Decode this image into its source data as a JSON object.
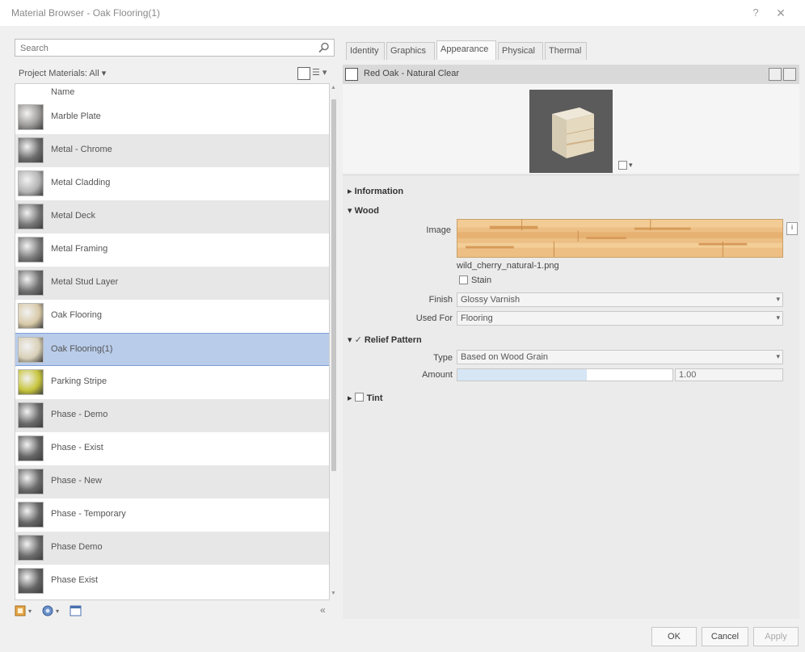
{
  "window": {
    "title": "Material Browser - Oak Flooring(1)",
    "help_glyph": "?",
    "close_glyph": "✕"
  },
  "left": {
    "search_placeholder": "Search",
    "filter_label": "Project Materials: All",
    "filter_arrow": "▾",
    "view_menu_glyph": "☰ ▾",
    "column_name": "Name",
    "items": [
      {
        "label": "Marble Plate",
        "thumb": "#9c9a98"
      },
      {
        "label": "Metal - Chrome",
        "thumb": "#6e6e6e"
      },
      {
        "label": "Metal Cladding",
        "thumb": "#b4b4b4"
      },
      {
        "label": "Metal Deck",
        "thumb": "#767676"
      },
      {
        "label": "Metal Framing",
        "thumb": "#7c7c7c"
      },
      {
        "label": "Metal Stud Layer",
        "thumb": "#727272"
      },
      {
        "label": "Oak Flooring",
        "thumb": "#d8c9a8"
      },
      {
        "label": "Oak Flooring(1)",
        "thumb": "#d8cfb7",
        "selected": true
      },
      {
        "label": "Parking Stripe",
        "thumb": "#c6c43c"
      },
      {
        "label": "Phase - Demo",
        "thumb": "#6a6a6a"
      },
      {
        "label": "Phase - Exist",
        "thumb": "#666666"
      },
      {
        "label": "Phase - New",
        "thumb": "#6b6b6b"
      },
      {
        "label": "Phase - Temporary",
        "thumb": "#676767"
      },
      {
        "label": "Phase Demo",
        "thumb": "#6c6c6c"
      },
      {
        "label": "Phase Exist",
        "thumb": "#646464"
      }
    ],
    "bottom_tools": [
      "material-library-icon",
      "create-material-icon",
      "asset-browser-icon"
    ],
    "collapse_glyph": "«"
  },
  "right": {
    "tabs": [
      "Identity",
      "Graphics",
      "Appearance",
      "Physical",
      "Thermal"
    ],
    "active_tab": "Appearance",
    "asset_name": "Red Oak - Natural Clear",
    "preview_options_glyph": "▾",
    "sections": {
      "information": "Information",
      "wood": "Wood",
      "relief": "Relief Pattern",
      "tint": "Tint"
    },
    "wood": {
      "image_label": "Image",
      "image_file": "wild_cherry_natural-1.png",
      "image_more_glyph": "i",
      "stain_label": "Stain",
      "finish_label": "Finish",
      "finish_value": "Glossy Varnish",
      "used_for_label": "Used For",
      "used_for_value": "Flooring"
    },
    "relief": {
      "type_label": "Type",
      "type_value": "Based on Wood Grain",
      "amount_label": "Amount",
      "amount_value": "1.00",
      "amount_fraction": 0.6
    },
    "dropdown_arrow": "▾"
  },
  "footer": {
    "ok": "OK",
    "cancel": "Cancel",
    "apply": "Apply"
  },
  "colors": {
    "selection": "#b9ccea",
    "wood_texture": "#e8b77a"
  }
}
